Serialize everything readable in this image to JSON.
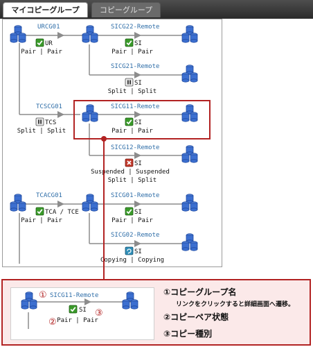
{
  "tabs": [
    {
      "label": "マイコピーグループ"
    },
    {
      "label": "コピーグループ"
    }
  ],
  "groups": [
    {
      "label": "URCG01"
    },
    {
      "label": "TCSCG01"
    },
    {
      "label": "TCACG01"
    }
  ],
  "remotes": [
    {
      "label": "SICG22-Remote"
    },
    {
      "label": "SICG21-Remote"
    },
    {
      "label": "SICG11-Remote"
    },
    {
      "label": "SICG12-Remote"
    },
    {
      "label": "SICG01-Remote"
    },
    {
      "label": "SICG02-Remote"
    }
  ],
  "pairs": [
    {
      "type": "UR",
      "status": "Pair | Pair",
      "icon": "check-icon"
    },
    {
      "type": "SI",
      "status": "Pair | Pair",
      "icon": "check-icon"
    },
    {
      "type": "SI",
      "status": "Split | Split",
      "icon": "pause-icon"
    },
    {
      "type": "TCS",
      "status": "Split | Split",
      "icon": "pause-icon"
    },
    {
      "type": "SI",
      "status": "Pair | Pair",
      "icon": "check-icon"
    },
    {
      "type": "SI",
      "status": "Suspended | Suspended",
      "status2": "Split | Split",
      "icon": "error-icon"
    },
    {
      "type": "TCA / TCE",
      "status": "Pair | Pair",
      "icon": "check-icon"
    },
    {
      "type": "SI",
      "status": "Pair | Pair",
      "icon": "check-icon"
    },
    {
      "type": "SI",
      "status": "Copying | Copying",
      "icon": "copy-icon"
    }
  ],
  "callout": {
    "sample_link": "SICG11-Remote",
    "sample_type": "SI",
    "sample_status": "Pair | Pair",
    "markers": [
      "①",
      "②",
      "③"
    ],
    "legend": [
      {
        "label": "①コピーグループ名",
        "sub": "リンクをクリックすると詳細画面へ遷移。"
      },
      {
        "label": "②コピーペア状態"
      },
      {
        "label": "③コピー種別"
      }
    ]
  },
  "colors": {
    "accent": "#b22222",
    "link": "#2f6ea8",
    "volume": "#3c6fd0",
    "check": "#3a9a2a"
  }
}
